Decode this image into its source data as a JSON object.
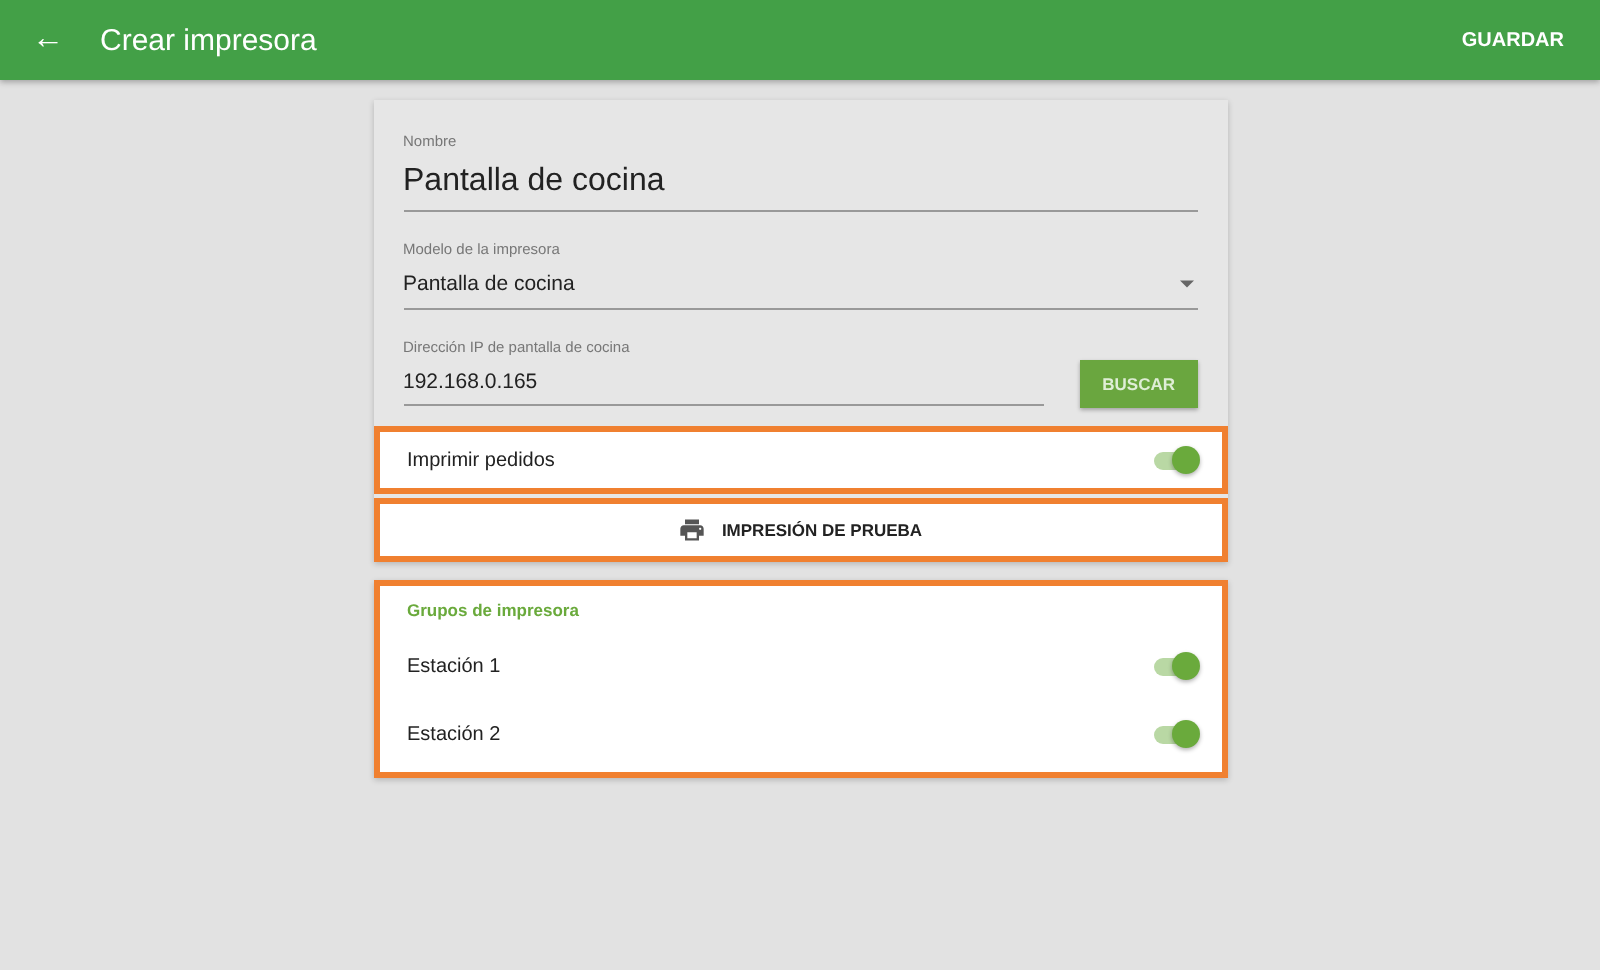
{
  "app_bar": {
    "back": "←",
    "title": "Crear impresora",
    "action": "GUARDAR"
  },
  "form": {
    "name": {
      "label": "Nombre",
      "value": "Pantalla de cocina"
    },
    "model": {
      "label": "Modelo de la impresora",
      "value": "Pantalla de cocina"
    },
    "ip": {
      "label": "Dirección IP de pantalla de cocina",
      "value": "192.168.0.165",
      "button": "BUSCAR"
    }
  },
  "print_orders": {
    "label": "Imprimir pedidos",
    "on": true,
    "highlighted": true
  },
  "test_print": {
    "label": "IMPRESIÓN DE PRUEBA",
    "highlighted": true
  },
  "groups": {
    "title": "Grupos de impresora",
    "highlighted": true,
    "items": [
      {
        "label": "Estación 1",
        "on": true
      },
      {
        "label": "Estación 2",
        "on": true
      }
    ]
  }
}
